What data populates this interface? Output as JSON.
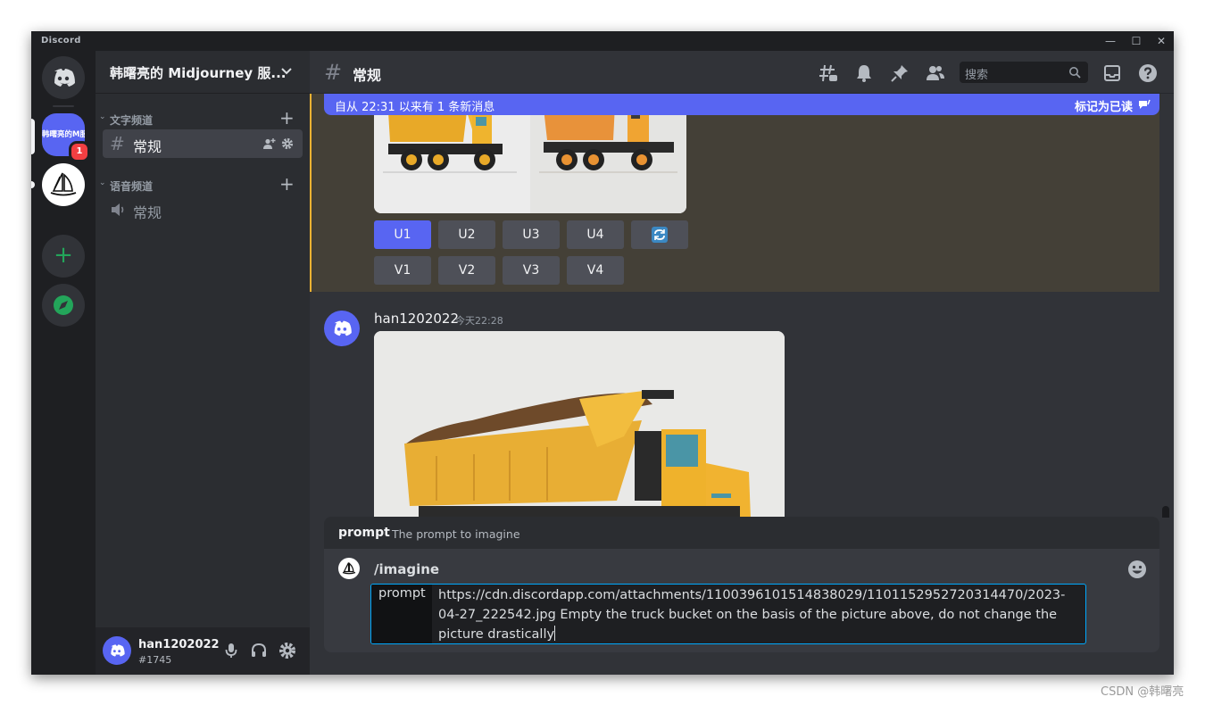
{
  "app": {
    "title": "Discord"
  },
  "window_controls": {
    "minimize": "—",
    "maximize": "☐",
    "close": "✕"
  },
  "servers": {
    "mj_abbrev": "韩曙亮的M服务",
    "mj_badge": "1",
    "add_symbol": "+"
  },
  "sidebar": {
    "server_name": "韩曙亮的 Midjourney 服...",
    "text_category": "文字频道",
    "voice_category": "语音频道",
    "text_channel": "常规",
    "voice_channel": "常规",
    "hash": "#"
  },
  "user": {
    "name": "han1202022",
    "tag": "#1745"
  },
  "header": {
    "channel": "常规",
    "search_placeholder": "搜索"
  },
  "new_messages": {
    "text": "自从 22:31 以来有 1 条新消息",
    "mark_read": "标记为已读"
  },
  "buttons": {
    "upscale": [
      "U1",
      "U2",
      "U3",
      "U4"
    ],
    "variation": [
      "V1",
      "V2",
      "V3",
      "V4"
    ]
  },
  "message": {
    "author": "han1202022",
    "timestamp": "今天22:28"
  },
  "command": {
    "hint_key": "prompt",
    "hint_value": "The prompt to imagine",
    "name": "/imagine",
    "option_name": "prompt",
    "option_value": "https://cdn.discordapp.com/attachments/1100396101514838029/1101152952720314470/2023-04-27_222542.jpg Empty the truck bucket on the basis of the picture above, do not change the picture drastically"
  },
  "watermark": "CSDN @韩曙亮",
  "colors": {
    "blurple": "#5865f2",
    "highlight_border": "#f0b232",
    "green": "#23a55a",
    "red": "#f23f42"
  }
}
